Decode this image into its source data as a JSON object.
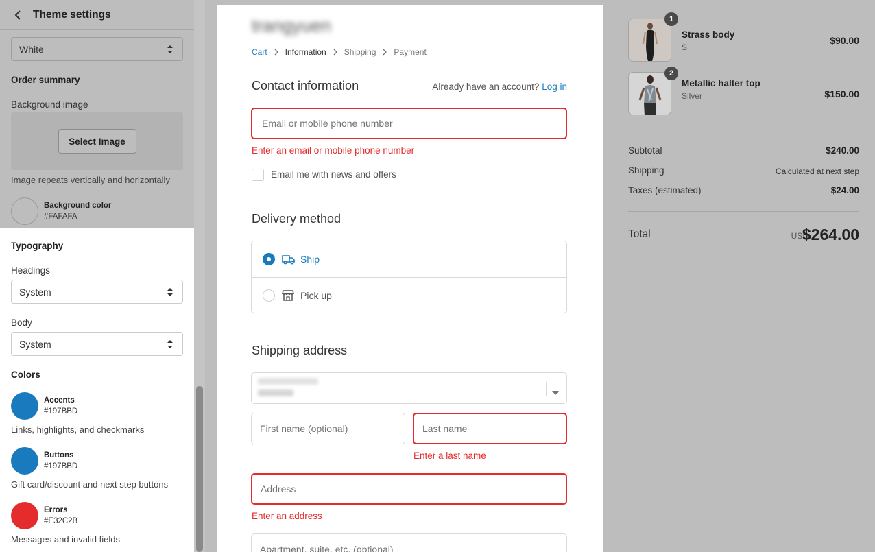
{
  "sidebar": {
    "title": "Theme settings",
    "background_select": "White",
    "order_summary_heading": "Order summary",
    "background_image_label": "Background image",
    "select_image_button": "Select Image",
    "image_help": "Image repeats vertically and horizontally",
    "background_color": {
      "name": "Background color",
      "hex": "#FAFAFA",
      "color": "#FAFAFA"
    },
    "typography_heading": "Typography",
    "headings_label": "Headings",
    "headings_value": "System",
    "body_label": "Body",
    "body_value": "System",
    "colors_heading": "Colors",
    "colors": [
      {
        "name": "Accents",
        "hex": "#197BBD",
        "color": "#197BBD",
        "description": "Links, highlights, and checkmarks"
      },
      {
        "name": "Buttons",
        "hex": "#197BBD",
        "color": "#197BBD",
        "description": "Gift card/discount and next step buttons"
      },
      {
        "name": "Errors",
        "hex": "#E32C2B",
        "color": "#E32C2B",
        "description": "Messages and invalid fields"
      }
    ]
  },
  "checkout": {
    "store_name": "trangyuen",
    "breadcrumbs": [
      {
        "label": "Cart",
        "state": "link"
      },
      {
        "label": "Information",
        "state": "current"
      },
      {
        "label": "Shipping",
        "state": "upcoming"
      },
      {
        "label": "Payment",
        "state": "upcoming"
      }
    ],
    "contact": {
      "heading": "Contact information",
      "have_account": "Already have an account?",
      "login_link": "Log in",
      "email_placeholder": "Email or mobile phone number",
      "email_error": "Enter an email or mobile phone number",
      "newsletter_label": "Email me with news and offers"
    },
    "delivery": {
      "heading": "Delivery method",
      "options": [
        {
          "label": "Ship",
          "icon": "truck-icon",
          "selected": true
        },
        {
          "label": "Pick up",
          "icon": "store-icon",
          "selected": false
        }
      ]
    },
    "shipping": {
      "heading": "Shipping address",
      "first_name_placeholder": "First name (optional)",
      "last_name_placeholder": "Last name",
      "last_name_error": "Enter a last name",
      "address_placeholder": "Address",
      "address_error": "Enter an address",
      "apartment_placeholder": "Apartment, suite, etc. (optional)"
    }
  },
  "summary": {
    "items": [
      {
        "qty": "1",
        "name": "Strass body",
        "variant": "S",
        "price": "$90.00"
      },
      {
        "qty": "2",
        "name": "Metallic halter top",
        "variant": "Silver",
        "price": "$150.00"
      }
    ],
    "subtotal_label": "Subtotal",
    "subtotal": "$240.00",
    "shipping_label": "Shipping",
    "shipping": "Calculated at next step",
    "taxes_label": "Taxes (estimated)",
    "taxes": "$24.00",
    "total_label": "Total",
    "currency": "USD",
    "total": "$264.00"
  },
  "colors": {
    "accent": "#197BBD",
    "error": "#E32C2B",
    "overlay": "#BDBDBD"
  }
}
